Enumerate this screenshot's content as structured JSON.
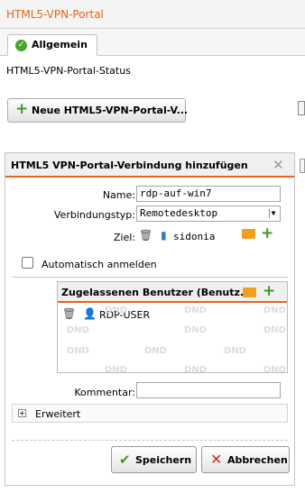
{
  "header": {
    "title": "HTML5-VPN-Portal"
  },
  "tabs": [
    {
      "label": "Allgemein",
      "active": true
    }
  ],
  "main": {
    "status_label": "HTML5-VPN-Portal-Status",
    "new_button_label": "Neue HTML5-VPN-Portal-V..."
  },
  "dialog": {
    "title": "HTML5 VPN-Portal-Verbindung hinzufügen",
    "fields": {
      "name_label": "Name:",
      "name_value": "rdp-auf-win7",
      "type_label": "Verbindungstyp:",
      "type_value": "Remotedesktop",
      "target_label": "Ziel:",
      "target_value": "sidonia",
      "auto_login_label": "Automatisch anmelden",
      "auto_login_checked": false,
      "comment_label": "Kommentar:",
      "comment_value": ""
    },
    "users": {
      "title": "Zugelassenen Benutzer (Benutz...",
      "items": [
        {
          "name": "RDP-USER"
        }
      ],
      "dnd_watermark": "DND"
    },
    "advanced_label": "Erweitert",
    "save_label": "Speichern",
    "cancel_label": "Abbrechen"
  },
  "colors": {
    "accent": "#e8641b",
    "add_green": "#3c9a1f",
    "cancel_red": "#d62a1b",
    "folder_orange": "#f0a020",
    "entity_blue": "#2c7dc3"
  }
}
